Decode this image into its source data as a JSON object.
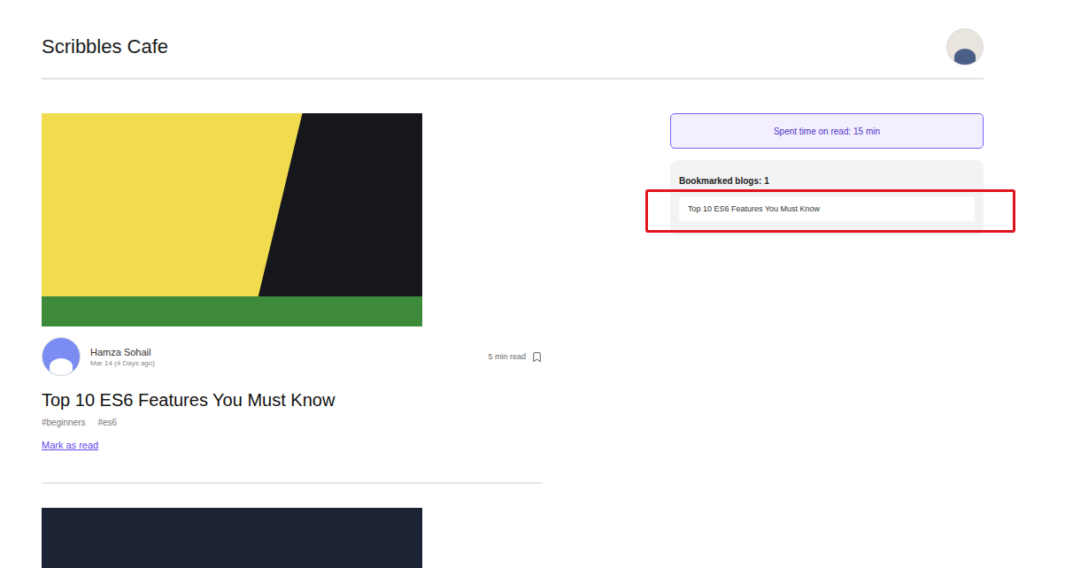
{
  "header": {
    "title": "Scribbles Cafe"
  },
  "blogs": [
    {
      "kind": "full",
      "color": "#f1dc4e",
      "author": "Hamza Sohail",
      "date": "Mar 14 (4 Days ago)",
      "read_time": "5 min read",
      "title": "Top 10 ES6 Features You Must Know",
      "tags": [
        "#beginners",
        "#es6"
      ],
      "action": "Mark as read"
    },
    {
      "kind": "cover",
      "color": "#1b2335"
    }
  ],
  "spent_time": "Spent time on read: 15 min",
  "bookmarks": {
    "title": "Bookmarked blogs: 1",
    "items": [
      {
        "title": "Top 10 ES6 Features You Must Know",
        "highlighted": true
      }
    ]
  }
}
